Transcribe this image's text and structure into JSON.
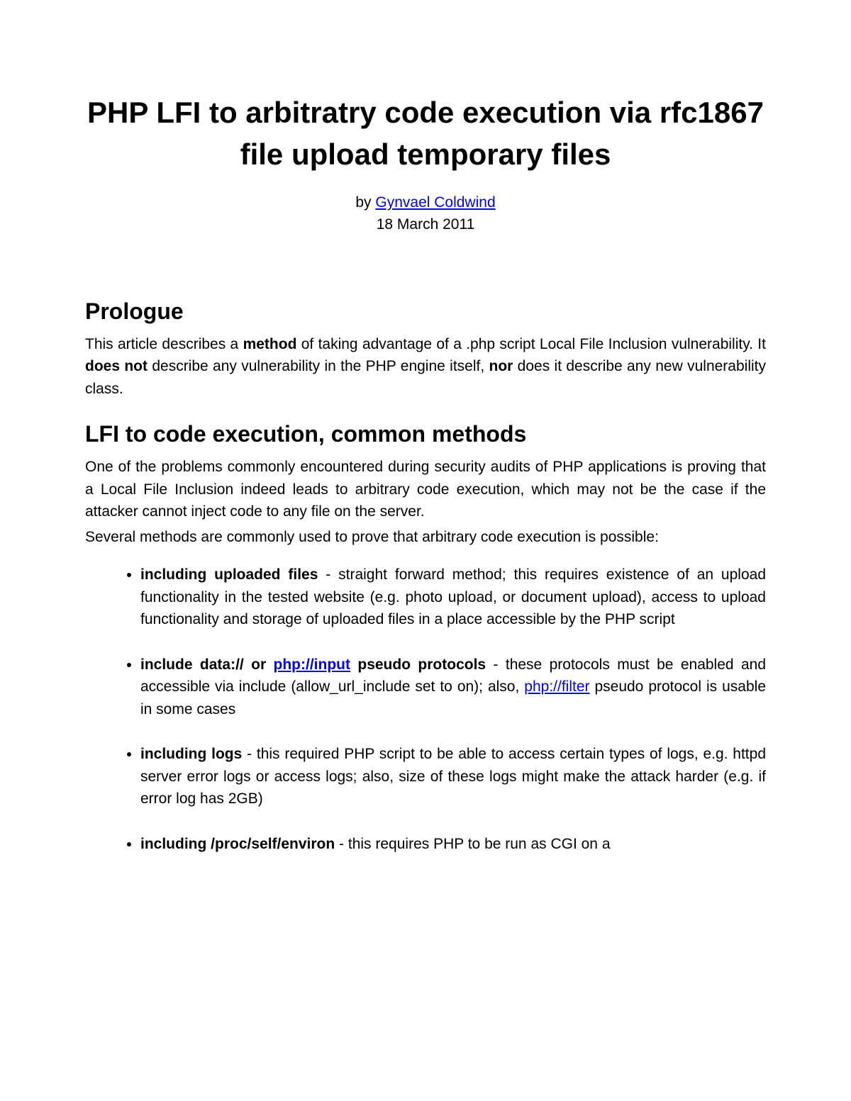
{
  "title": "PHP LFI to arbitratry code execution via rfc1867 file upload temporary files",
  "byline": {
    "by": "by ",
    "author": "Gynvael Coldwind",
    "date": "18 March 2011"
  },
  "sections": {
    "prologue": {
      "heading": "Prologue",
      "text_parts": {
        "p1a": "This article describes a ",
        "p1b": "method",
        "p1c": " of taking advantage of a .php script Local File Inclusion vulnerability. It ",
        "p1d": "does not",
        "p1e": " describe any vulnerability in the PHP engine itself, ",
        "p1f": "nor",
        "p1g": " does it describe any new vulnerability class."
      }
    },
    "methods": {
      "heading": "LFI to code execution, common methods",
      "intro1": "One of the problems commonly encountered during security audits of PHP applications is proving that a Local File Inclusion indeed leads to arbitrary code execution, which may not be the case if the attacker cannot inject code to any file on the server.",
      "intro2": "Several methods are commonly used to prove that arbitrary code execution is possible:",
      "items": {
        "item1": {
          "bold": "including uploaded files",
          "rest": " - straight forward method; this requires existence of an upload functionality in the tested website (e.g. photo upload, or document upload), access to upload functionality and storage of uploaded files in a place accessible by the PHP script"
        },
        "item2": {
          "bold1": "include data:// or ",
          "link1": "php://input",
          "bold2": " pseudo protocols",
          "rest1": " - these protocols must be enabled and accessible via include (allow_url_include set to on); also, ",
          "link2": "php://filter",
          "rest2": " pseudo protocol is usable in some cases"
        },
        "item3": {
          "bold": "including logs",
          "rest": " - this required PHP script to be able to access certain types of logs, e.g. httpd server error logs or access logs; also, size of these logs might make the attack harder (e.g. if error log has 2GB)"
        },
        "item4": {
          "bold": "including /proc/self/environ",
          "rest": " - this requires PHP to be run as CGI on a"
        }
      }
    }
  }
}
